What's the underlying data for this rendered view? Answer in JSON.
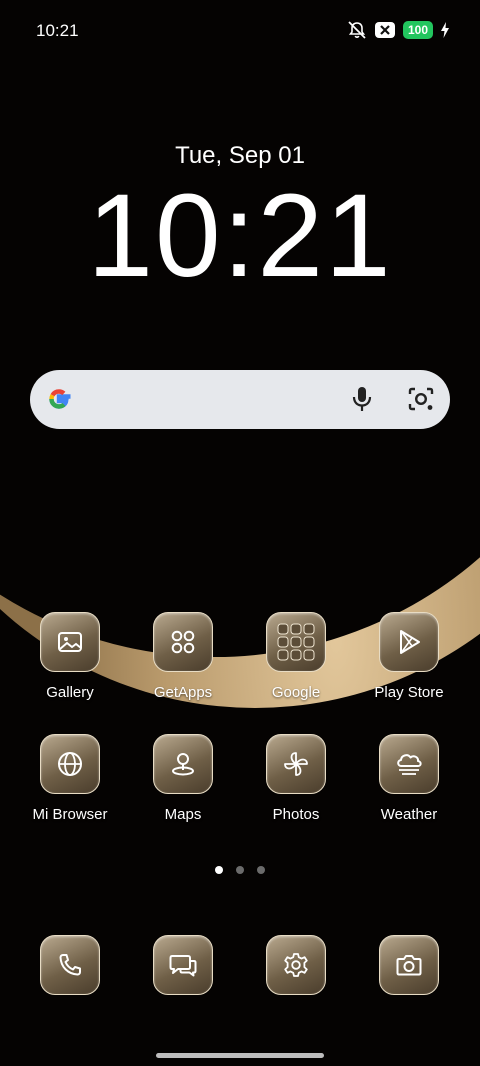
{
  "status_bar": {
    "time": "10:21",
    "battery": "100",
    "icons": [
      "bell-off-icon",
      "x-badge-icon",
      "battery-icon",
      "charging-bolt-icon"
    ]
  },
  "lock_clock": {
    "date": "Tue, Sep 01",
    "time": "10:21"
  },
  "search": {
    "icons": [
      "google-logo-icon",
      "microphone-icon",
      "google-lens-icon"
    ]
  },
  "apps": [
    {
      "label": "Gallery",
      "icon": "gallery-icon"
    },
    {
      "label": "GetApps",
      "icon": "getapps-icon"
    },
    {
      "label": "Google",
      "icon": "folder-icon"
    },
    {
      "label": "Play Store",
      "icon": "play-store-icon"
    },
    {
      "label": "Mi Browser",
      "icon": "globe-icon"
    },
    {
      "label": "Maps",
      "icon": "map-pin-icon"
    },
    {
      "label": "Photos",
      "icon": "pinwheel-icon"
    },
    {
      "label": "Weather",
      "icon": "cloud-icon"
    }
  ],
  "dock": [
    "phone-icon",
    "messages-icon",
    "settings-icon",
    "camera-icon"
  ],
  "page_indicator": {
    "pages": 3,
    "active": 1
  },
  "colors": {
    "icon_tile": "#8a7a60",
    "battery": "#22c55e",
    "search_bar": "#e6e8ec"
  }
}
